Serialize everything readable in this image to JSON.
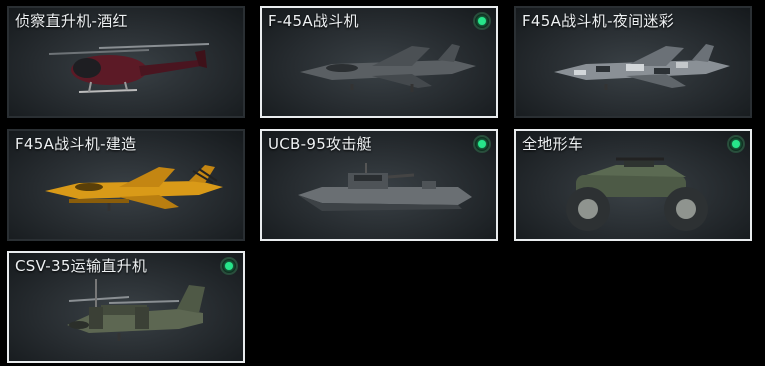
{
  "cards": [
    {
      "label": "侦察直升机-酒红",
      "selected": false,
      "owned": false,
      "icon": "scout-helicopter-icon"
    },
    {
      "label": "F-45A战斗机",
      "selected": true,
      "owned": true,
      "icon": "fighter-jet-icon"
    },
    {
      "label": "F45A战斗机-夜间迷彩",
      "selected": false,
      "owned": false,
      "icon": "camo-fighter-jet-icon"
    },
    {
      "label": "F45A战斗机-建造",
      "selected": false,
      "owned": false,
      "icon": "yellow-fighter-jet-icon"
    },
    {
      "label": "UCB-95攻击艇",
      "selected": true,
      "owned": true,
      "icon": "attack-boat-icon"
    },
    {
      "label": "全地形车",
      "selected": true,
      "owned": true,
      "icon": "atv-icon"
    },
    {
      "label": "CSV-35运输直升机",
      "selected": true,
      "owned": true,
      "icon": "tiltrotor-icon"
    }
  ],
  "colors": {
    "owned_indicator": "#27e58a",
    "selected_border": "#e9ecee"
  }
}
